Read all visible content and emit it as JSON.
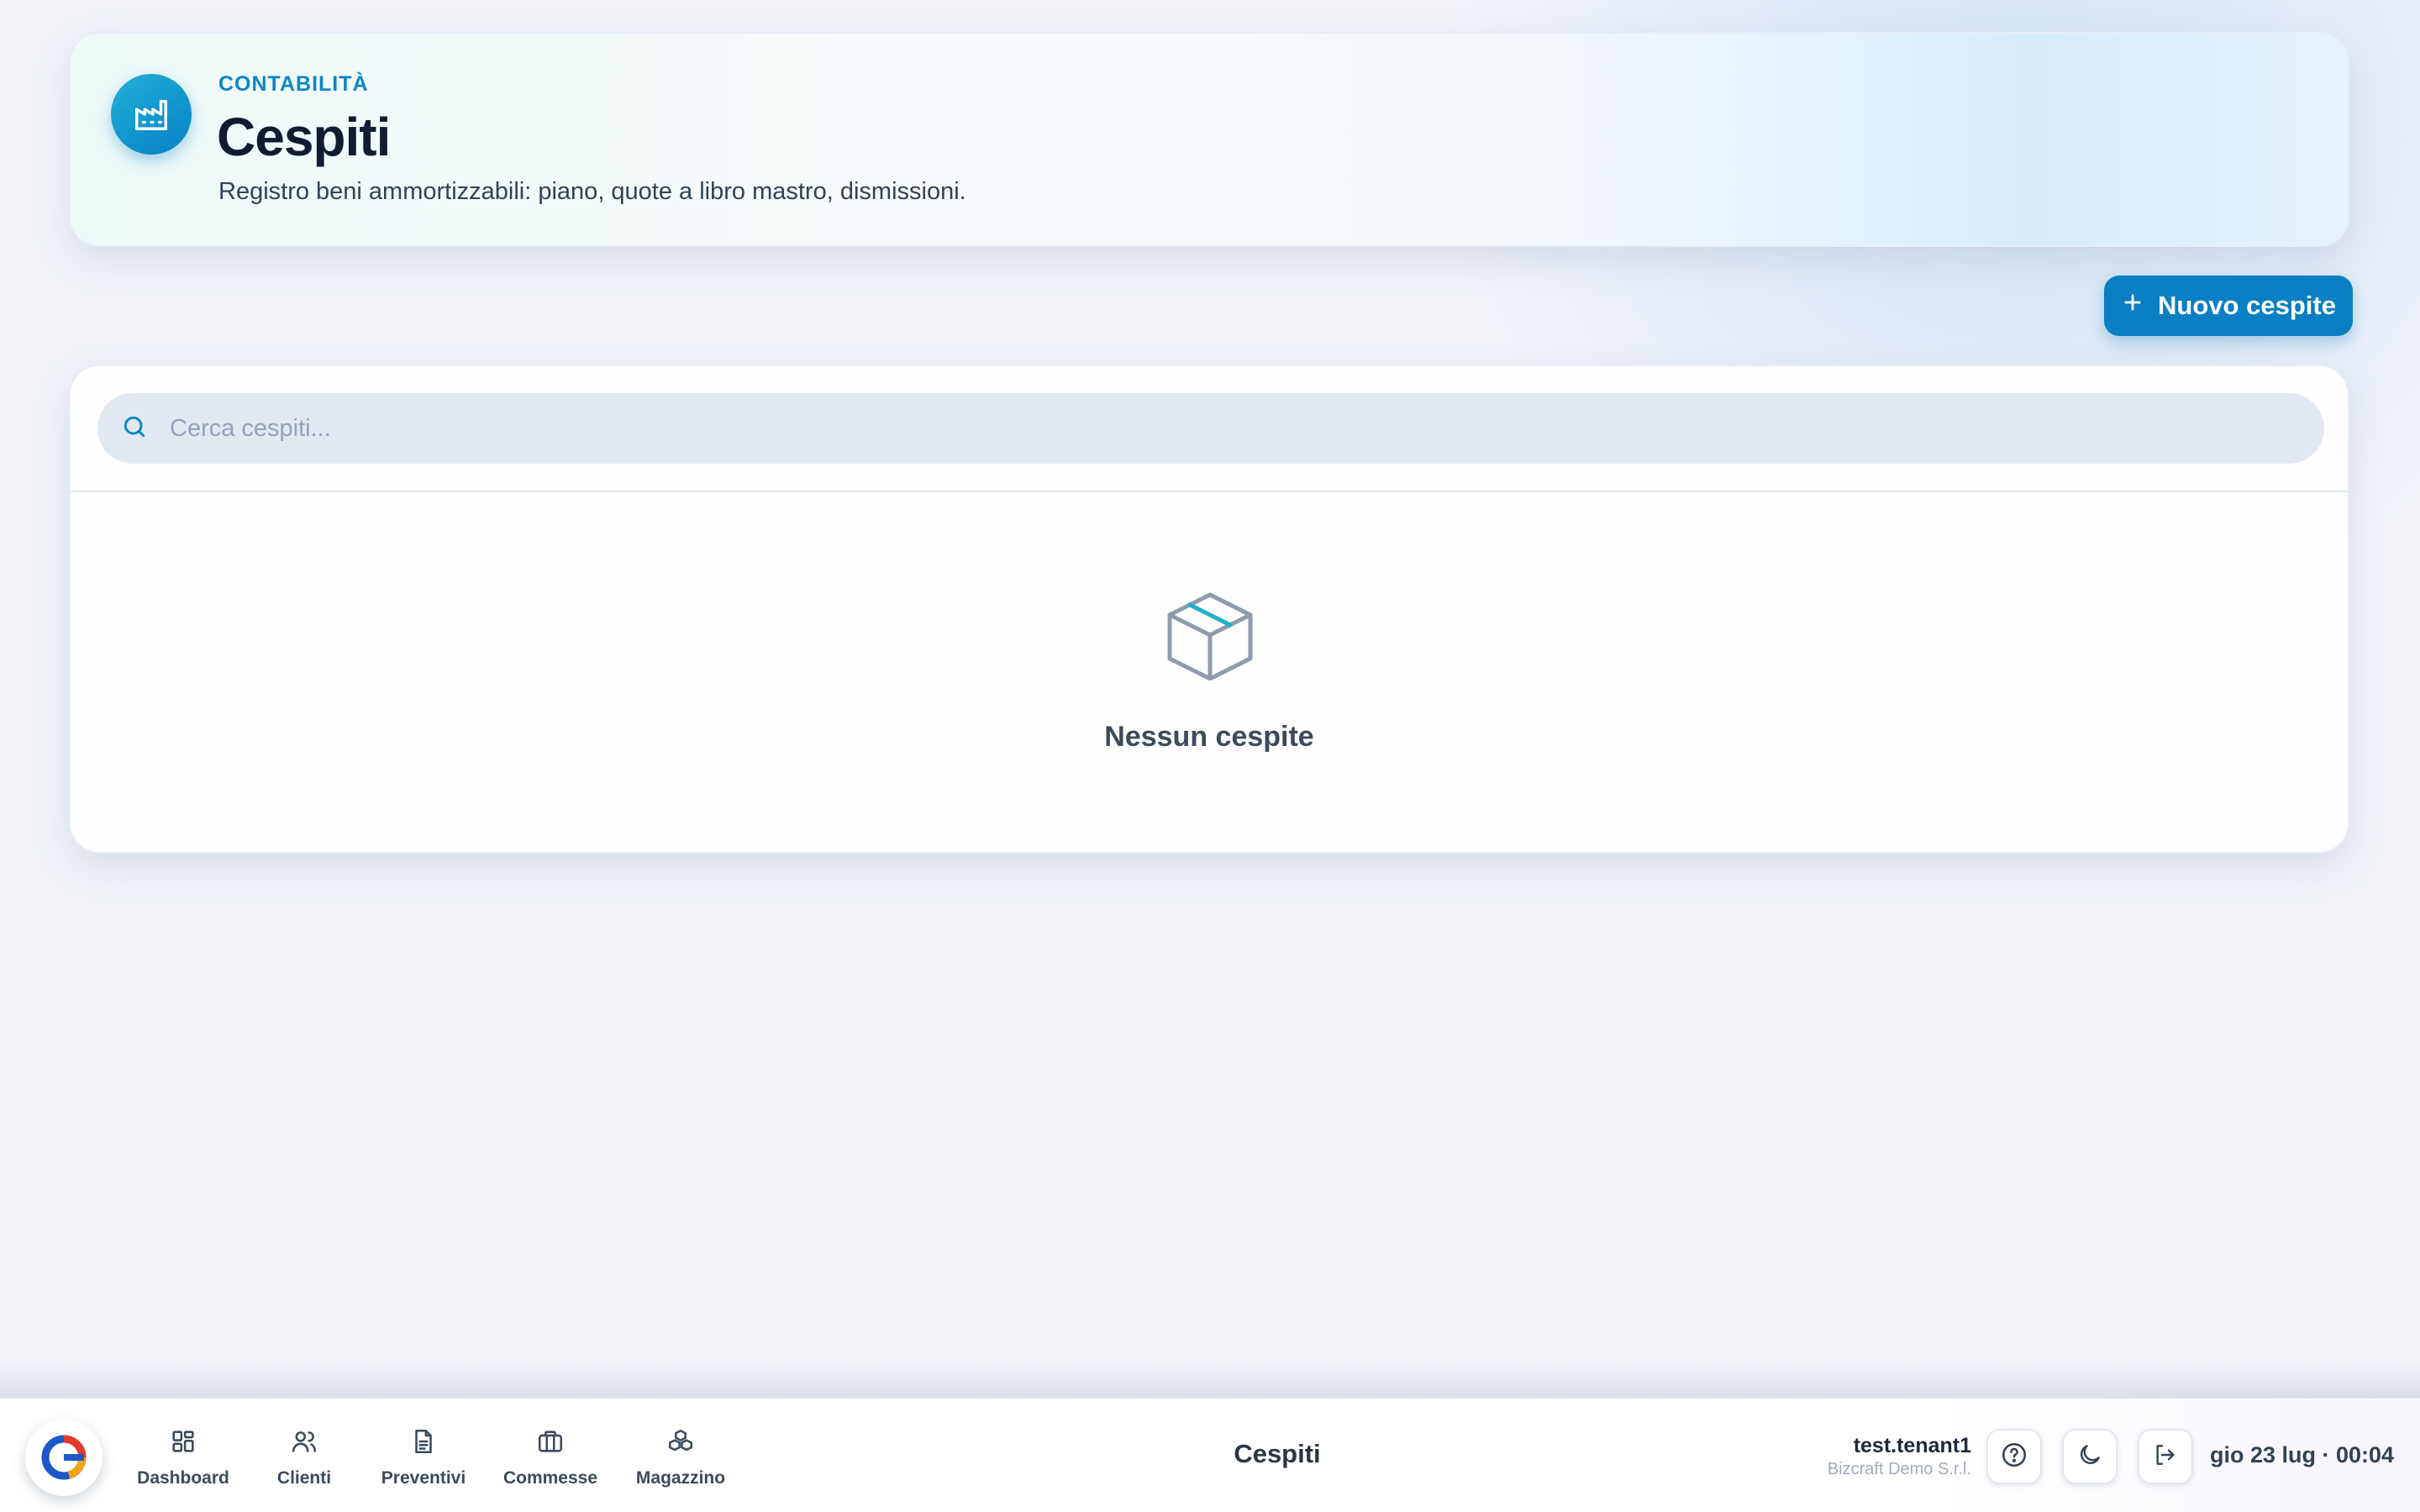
{
  "header": {
    "eyebrow": "CONTABILITÀ",
    "title": "Cespiti",
    "subtitle": "Registro beni ammortizzabili: piano, quote a libro mastro, dismissioni.",
    "icon": "factory-icon"
  },
  "toolbar": {
    "new_label": "Nuovo cespite",
    "new_icon": "plus-icon"
  },
  "search": {
    "placeholder": "Cerca cespiti...",
    "value": ""
  },
  "empty_state": {
    "icon": "package-icon",
    "text": "Nessun cespite"
  },
  "bottom_nav": {
    "items": [
      {
        "label": "Dashboard",
        "icon": "dashboard-icon"
      },
      {
        "label": "Clienti",
        "icon": "users-icon"
      },
      {
        "label": "Preventivi",
        "icon": "document-icon"
      },
      {
        "label": "Commesse",
        "icon": "briefcase-icon"
      },
      {
        "label": "Magazzino",
        "icon": "boxes-icon"
      }
    ],
    "current_page": "Cespiti"
  },
  "user": {
    "name": "test.tenant1",
    "company": "Bizcraft Demo S.r.l."
  },
  "actions": {
    "help_icon": "help-icon",
    "theme_icon": "moon-icon",
    "logout_icon": "logout-icon"
  },
  "datetime": "gio 23 lug · 00:04",
  "colors": {
    "accent": "#0a7fc3",
    "eyebrow": "#0b86c8",
    "background": "#f0f2f8"
  }
}
